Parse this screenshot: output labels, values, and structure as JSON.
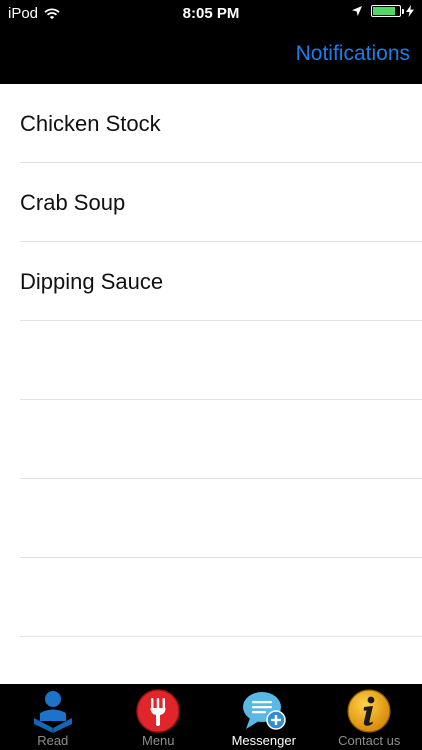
{
  "status_bar": {
    "carrier": "iPod",
    "time": "8:05 PM",
    "battery_fill_fraction": 0.85
  },
  "nav": {
    "title": "Notifications"
  },
  "list": {
    "items": [
      {
        "label": "Chicken Stock"
      },
      {
        "label": "Crab Soup"
      },
      {
        "label": "Dipping Sauce"
      },
      {
        "label": ""
      },
      {
        "label": ""
      },
      {
        "label": ""
      },
      {
        "label": ""
      },
      {
        "label": ""
      }
    ]
  },
  "tabbar": {
    "tabs": [
      {
        "label": "Read",
        "icon": "reader-icon"
      },
      {
        "label": "Menu",
        "icon": "fork-icon"
      },
      {
        "label": "Messenger",
        "icon": "chat-bubble-icon"
      },
      {
        "label": "Contact us",
        "icon": "info-icon"
      }
    ],
    "active": "Messenger"
  },
  "colors": {
    "accent": "#1b7ee8",
    "bar_background": "#000000",
    "separator": "#e2e2e2",
    "battery": "#4cd964"
  }
}
